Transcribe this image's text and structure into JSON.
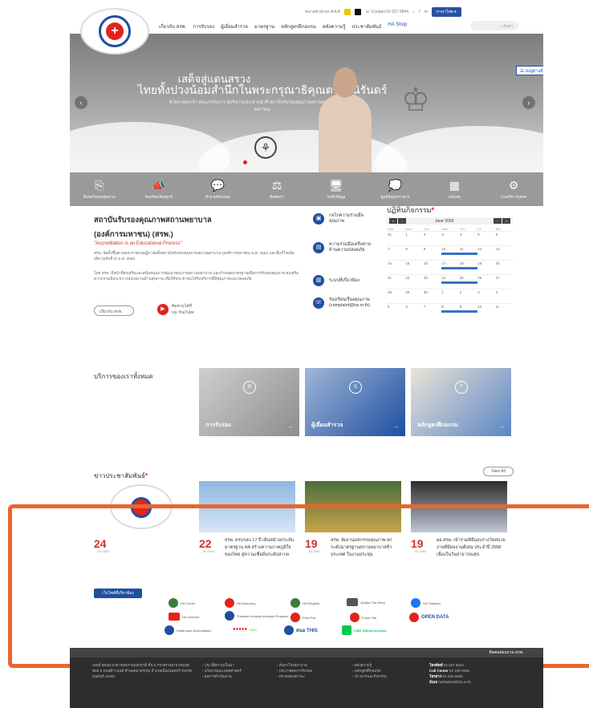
{
  "header": {
    "lang_label": "ภาษาไทย ▾",
    "nav": [
      "เกี่ยวกับ สรพ.",
      "การรับรอง",
      "ผู้เยี่ยมสำรวจ",
      "มาตรฐาน",
      "หลักสูตรฝึกอบรม",
      "คลังความรู้",
      "ประชาสัมพันธ์",
      "HA Shop"
    ],
    "search_placeholder": "ค้นหา"
  },
  "hero": {
    "title_line1": "เสด็จสู่แดนสรวง",
    "title_line2": "ไทยทั้งปวงน้อมสำนึกในพระกรุณาธิคุณตราบนิรันดร์",
    "subtitle": "ข้าพระพุทธเจ้า คณะกรรมการ ผู้บริหารและเจ้าหน้าที่ สถาบันรับรองคุณภาพสถานพยาบาล (องค์การมหาชน)",
    "menu_label": "☰ เมนูทางลัด",
    "prev": "‹",
    "next": "›"
  },
  "quick_links": [
    {
      "icon": "⎘",
      "label": "ยื่นขอรับรองคุณภาพ"
    },
    {
      "icon": "📣",
      "label": "ร้องเรียน/ร้องทุกข์"
    },
    {
      "icon": "💬",
      "label": "คำถามที่พบบ่อย"
    },
    {
      "icon": "⚖",
      "label": "ติดต่อเรา"
    },
    {
      "icon": "🖥",
      "label": "บันทึกข้อมูล"
    },
    {
      "icon": "💭",
      "label": "ศูนย์ข้อมูลข่าวสาร"
    },
    {
      "icon": "▦",
      "label": "แจ้งเหตุ"
    },
    {
      "icon": "⚙",
      "label": "งานบริหารบุคคล"
    }
  ],
  "about": {
    "title_line1": "สถาบันรับรองคุณภาพสถานพยาบาล",
    "title_line2": "(องค์การมหาชน) (สรพ.)",
    "quote": "\"Accreditation is an Educational Process\"",
    "para1": "สรพ. จัดตั้งขึ้นตามพระราชกฤษฎีกาจัดตั้งสถาบันรับรองคุณภาพสถานพยาบาล (องค์การมหาชน) พ.ศ. 2552 และที่แก้ไขเพิ่มเติม (ฉบับที่ 2) พ.ศ. 2562",
    "para2": "โดย สรพ. มีหน้าที่ส่งเสริมและสนับสนุนการพัฒนาคุณภาพสถานพยาบาล และกำหนดมาตรฐานเพื่อการรับรองคุณภาพ ส่งเสริมความร่วมมือระหว่างหน่วยงานด้านสุขภาพ เพื่อให้ประชาชนได้รับบริการที่มีคุณภาพและปลอดภัย",
    "more_label": "เกี่ยวกับ สรพ.",
    "youtube_label1": "ติดตามได้ที่",
    "youtube_label2": "บน YouTube"
  },
  "features": [
    {
      "icon": "▣",
      "label": "กลไกความร่วมมือคุณภาพ"
    },
    {
      "icon": "▤",
      "label": "ความร่วมมือเครือข่ายด้านความปลอดภัย"
    },
    {
      "icon": "▥",
      "label": "ระบบที่เกี่ยวข้อง"
    },
    {
      "icon": "☏",
      "label": "ร้องเรียนเรื่องคุณภาพ (complaint@ha.or.th)"
    }
  ],
  "calendar": {
    "title": "ปฏิทินกิจกรรม",
    "month": "June 2020",
    "days": [
      "Sun",
      "Mon",
      "Tue",
      "Wed",
      "Thu",
      "Fri",
      "Sat"
    ],
    "weeks": [
      [
        "31",
        "1",
        "2",
        "3",
        "4",
        "5",
        "6"
      ],
      [
        "7",
        "8",
        "9",
        "10",
        "11",
        "12",
        "13"
      ],
      [
        "14",
        "15",
        "16",
        "17",
        "18",
        "19",
        "20"
      ],
      [
        "21",
        "22",
        "23",
        "24",
        "25",
        "26",
        "27"
      ],
      [
        "28",
        "29",
        "30",
        "1",
        "2",
        "3",
        "4"
      ],
      [
        "5",
        "6",
        "7",
        "8",
        "9",
        "10",
        "11"
      ]
    ]
  },
  "services": {
    "title": "บริการของเราทั้งหมด",
    "items": [
      {
        "label": "การรับรอง",
        "icon": "R"
      },
      {
        "label": "ผู้เยี่ยมสำรวจ",
        "icon": "S"
      },
      {
        "label": "หลักสูตรฝึกอบรม",
        "icon": "T"
      }
    ]
  },
  "news": {
    "title": "ข่าวประชาสัมพันธ์",
    "view_all": "View All",
    "items": [
      {
        "day": "24",
        "month": "Jul 2563",
        "text": ""
      },
      {
        "day": "22",
        "month": "Jul 2563",
        "text": "สรพ. ครบรอบ 17 ปี เดินหน้ายกระดับมาตรฐาน HA สร้างความภาคภูมิใจของไทย สู่ความเชื่อมั่นระดับสากล"
      },
      {
        "day": "19",
        "month": "Jul 2563",
        "text": "สรพ. จัดงานมหกรรมคุณภาพ ยกระดับมาตรฐานสถานพยาบาลทั่วประเทศ ในงานประชุม"
      },
      {
        "day": "19",
        "month": "Jul 2563",
        "text": "ผอ.สรพ. เข้าร่วมพิธีมอบรางวัลหน่วยงานที่มีผลงานดีเด่น ประจำปี 2568 เนื่องในวันสาธารณสุข"
      }
    ]
  },
  "related": {
    "button": "เว็บไซต์ที่เกี่ยวข้อง",
    "sites": [
      "HA Forum",
      "HA Elearning",
      "HA Register",
      "Quality Tha Story",
      "HA Thailand",
      "HA Channel",
      "Thailand Hospital Indicator Program",
      "Phra Pak",
      "Fresh Pak",
      "OPEN DATA",
      "Healthcare Accreditation",
      "Sorn",
      "สนอ THIS",
      "LINE Official Account"
    ]
  },
  "footer": {
    "contact_button": "ติดต่อสอบถาม สรพ.",
    "address": "เลขที่ 88/39 อาคารสุขภาพแห่งชาติ ชั้น 5 กระทรวงสาธารณสุข ซอย 6 ถนนติวานนท์ ตำบลตลาดขวัญ อำเภอเมืองนนทบุรี จังหวัดนนทบุรี 11000",
    "col2": [
      "› ประวัติความเป็นมา",
      "› นโยบายและยุทธศาสตร์",
      "› ผลการดำเนินงาน"
    ],
    "col3": [
      "› ค้นหาโรงพยาบาล",
      "› ประกาศผลการรับรอง",
      "› ตรวจสอบสถานะ"
    ],
    "col4": [
      "› คลังความรู้",
      "› หลักสูตรฝึกอบรม",
      "› ข่าวสารและกิจกรรม"
    ],
    "contacts": [
      {
        "label": "โทรศัพท์",
        "value": "02 027 8844"
      },
      {
        "label": "Call Center",
        "value": "02 105 0555"
      },
      {
        "label": "โทรสาร",
        "value": "02 026 6680"
      },
      {
        "label": "อีเมล",
        "value": "hathailand@ha.or.th"
      }
    ]
  }
}
